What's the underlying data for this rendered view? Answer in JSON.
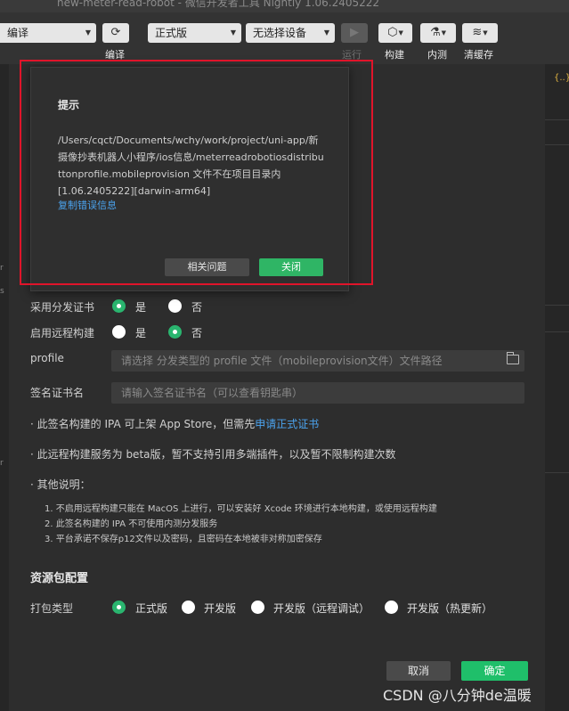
{
  "window": {
    "title": "new-meter-read-robot - 微信开发者工具 Nightly 1.06.2405222"
  },
  "toolbar": {
    "compile_select": "编译",
    "compile_label": "编译",
    "env_select": "正式版",
    "device_select": "无选择设备",
    "run_label": "运行",
    "build_label": "构建",
    "test_label": "内测",
    "cache_label": "清缓存"
  },
  "right_panel": {
    "bracket": "{..}"
  },
  "form": {
    "dist_cert_label": "采用分发证书",
    "remote_build_label": "启用远程构建",
    "yes": "是",
    "no": "否",
    "profile_label": "profile",
    "profile_placeholder": "请选择 分发类型的 profile 文件（mobileprovision文件）文件路径",
    "cert_name_label": "签名证书名",
    "cert_name_placeholder": "请输入签名证书名（可以查看钥匙串）",
    "note1_prefix": "· 此签名构建的 IPA 可上架 App Store，但需先",
    "note1_link": "申请正式证书",
    "note2": "· 此远程构建服务为 beta版，暂不支持引用多端插件，以及暂不限制构建次数",
    "note3": "· 其他说明：",
    "details": [
      "1. 不启用远程构建只能在 MacOS 上进行，可以安装好 Xcode 环境进行本地构建，或使用远程构建",
      "2. 此签名构建的 IPA 不可使用内测分发服务",
      "3. 平台承诺不保存p12文件以及密码，且密码在本地被非对称加密保存"
    ],
    "resource_section": "资源包配置",
    "package_type_label": "打包类型",
    "package_types": [
      "正式版",
      "开发版",
      "开发版（远程调试）",
      "开发版（热更新）"
    ],
    "cancel": "取消",
    "confirm": "确定"
  },
  "alert": {
    "title": "提示",
    "message": "/Users/cqct/Documents/wchy/work/project/uni-app/新摄像抄表机器人小程序/ios信息/meterreadrobotiosdistributtonprofile.mobileprovision 文件不在项目目录内\n[1.06.2405222][darwin-arm64]",
    "copy_link": "复制错误信息",
    "related_button": "相关问题",
    "close_button": "关闭"
  },
  "watermark": "CSDN @八分钟de温暖",
  "colors": {
    "accent_green": "#2ab56f",
    "link_blue": "#4ba3ee",
    "highlight_red": "#e0142a"
  }
}
